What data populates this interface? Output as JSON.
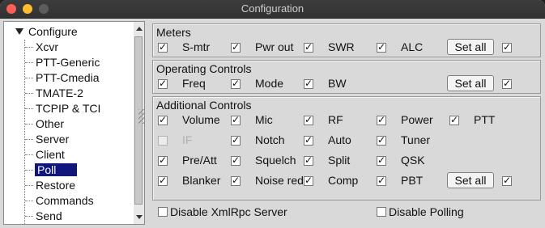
{
  "window": {
    "title": "Configuration"
  },
  "tree": {
    "root": "Configure",
    "items": [
      "Xcvr",
      "PTT-Generic",
      "PTT-Cmedia",
      "TMATE-2",
      "TCPIP & TCI",
      "Other",
      "Server",
      "Client",
      "Poll",
      "Restore",
      "Commands",
      "Send"
    ],
    "selected": "Poll"
  },
  "meters": {
    "title": "Meters",
    "labels": [
      "S-mtr",
      "Pwr out",
      "SWR",
      "ALC"
    ],
    "button": "Set all"
  },
  "operating": {
    "title": "Operating Controls",
    "labels": [
      "Freq",
      "Mode",
      "BW"
    ],
    "button": "Set all"
  },
  "additional": {
    "title": "Additional Controls",
    "row1": [
      "Volume",
      "Mic",
      "RF",
      "Power",
      "PTT"
    ],
    "row2": [
      "IF",
      "Notch",
      "Auto",
      "Tuner"
    ],
    "row3": [
      "Pre/Att",
      "Squelch",
      "Split",
      "QSK"
    ],
    "row4": [
      "Blanker",
      "Noise red",
      "Comp",
      "PBT"
    ],
    "button": "Set all"
  },
  "footer": {
    "disable_xmlrpc": "Disable XmlRpc Server",
    "disable_polling": "Disable Polling"
  }
}
